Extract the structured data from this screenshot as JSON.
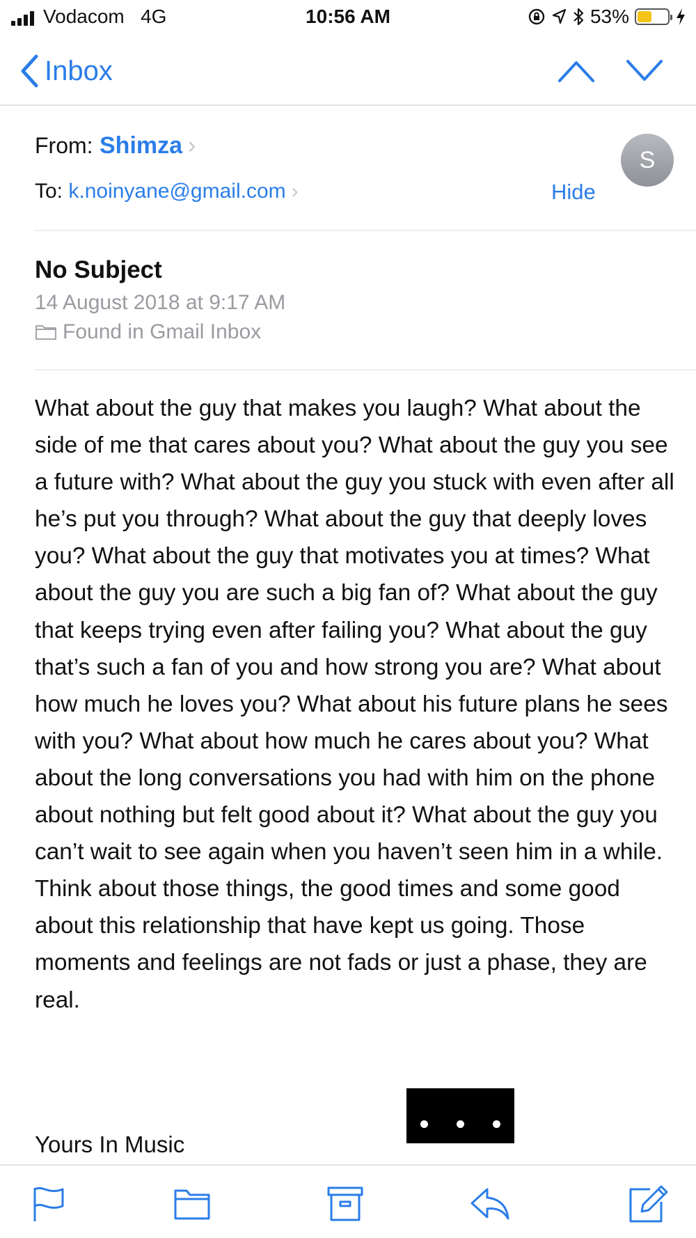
{
  "status_bar": {
    "carrier": "Vodacom",
    "network": "4G",
    "time": "10:56 AM",
    "battery_percent": "53%",
    "battery_level": 0.53,
    "icons": [
      "signal-icon",
      "orientation-lock-icon",
      "location-icon",
      "bluetooth-icon",
      "battery-icon",
      "charging-icon"
    ]
  },
  "nav": {
    "back_label": "Inbox",
    "icons": [
      "chevron-left-icon",
      "chevron-up-icon",
      "chevron-down-icon"
    ]
  },
  "header": {
    "from_label": "From:",
    "from_name": "Shimza",
    "to_label": "To:",
    "to_address": "k.noinyane@gmail.com",
    "hide_label": "Hide",
    "avatar_initial": "S"
  },
  "message": {
    "subject": "No Subject",
    "date": "14 August 2018 at 9:17 AM",
    "mailbox": "Found in Gmail Inbox",
    "body": "What about the guy that makes you laugh? What about the side of me that cares about you? What about the guy you see a future with? What about the guy you stuck with even after all he’s put you through? What about the guy that deeply loves you? What about the guy that motivates you at times? What about the guy you are such a big fan of? What about the guy that keeps trying even after failing you? What about the guy that’s such a fan of you and how strong you are? What about how much he loves you? What about his future plans he sees with you? What about how much he cares about you? What about the long conversations you had with him on the phone about nothing but felt good about it? What about the guy you can’t wait to see again when you haven’t seen him in a while. Think about those things, the good times and some good about this relationship that have kept us going. Those moments and feelings are not fads or just a phase, they are real.",
    "signature": "Yours In Music"
  },
  "toolbar": {
    "icons": [
      "flag-icon",
      "folder-icon",
      "archive-icon",
      "reply-icon",
      "compose-icon"
    ]
  },
  "colors": {
    "accent": "#2b7de9",
    "secondary_text": "#9a9aa0",
    "battery_fill": "#f4c419",
    "avatar": "#9fa1a7"
  }
}
